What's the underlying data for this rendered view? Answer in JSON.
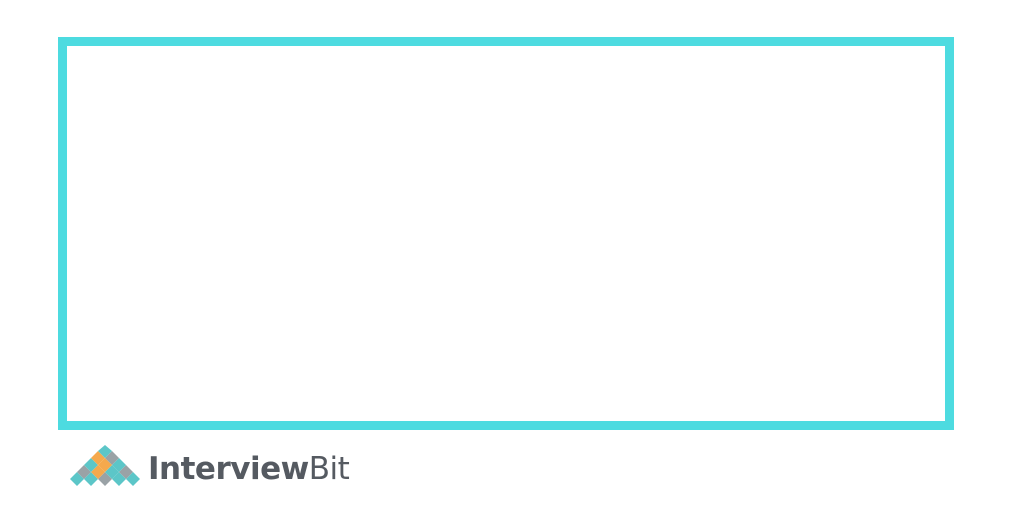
{
  "frame": {
    "border_color": "#4ddbe0",
    "content_text": ""
  },
  "brand": {
    "name_strong": "Interview",
    "name_light": "Bit",
    "logo_icon": "diamond-pyramid-logo-icon",
    "colors": {
      "teal": "#5cc6c8",
      "orange": "#f5a94d",
      "gray": "#9aa2a6",
      "text": "#555a61"
    }
  }
}
